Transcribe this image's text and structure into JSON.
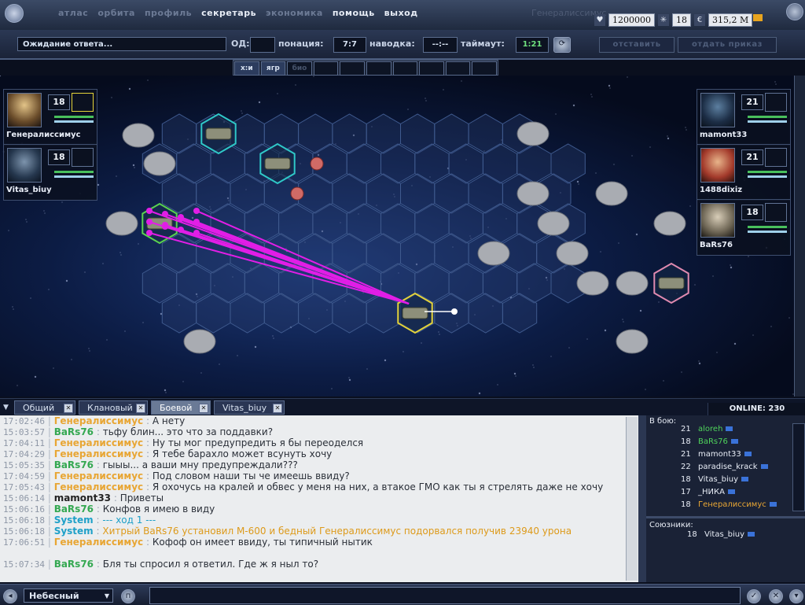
{
  "menu": {
    "items": [
      {
        "label": "атлас",
        "active": false
      },
      {
        "label": "орбита",
        "active": false
      },
      {
        "label": "профиль",
        "active": false
      },
      {
        "label": "секретарь",
        "active": true
      },
      {
        "label": "экономика",
        "active": false
      },
      {
        "label": "помощь",
        "active": true
      },
      {
        "label": "выход",
        "active": true
      }
    ],
    "player": "Генералиссимус"
  },
  "stats": {
    "money": "1200000",
    "level": "18",
    "mass": "315,2",
    "mass_unit": "М"
  },
  "status": {
    "message": "Ожидание ответа...",
    "og_label": "ОД:",
    "og_value": "",
    "ponaciya_label": "понация:",
    "ponaciya_value": "7:7",
    "navodka_label": "наводка:",
    "navodka_value": "--:--",
    "timeout_label": "таймаут:",
    "timeout_value": "1:21",
    "btn_leave": "отставить",
    "btn_order": "отдать приказ"
  },
  "mode_tabs": [
    "х:и",
    "ягр",
    "био",
    "",
    "",
    "",
    "",
    "",
    "",
    ""
  ],
  "left_players": [
    {
      "name": "Генералиссимус",
      "level": "18"
    },
    {
      "name": "Vitas_biuy",
      "level": "18"
    }
  ],
  "right_players": [
    {
      "name": "mamont33",
      "level": "21"
    },
    {
      "name": "1488dixiz",
      "level": "21"
    },
    {
      "name": "BaRs76",
      "level": "18"
    }
  ],
  "chat_tabs": [
    {
      "label": "Общий",
      "active": false
    },
    {
      "label": "Клановый",
      "active": false
    },
    {
      "label": "Боевой",
      "active": true
    },
    {
      "label": "Vitas_biuy",
      "active": false
    }
  ],
  "online": "ONLINE: 230",
  "messages": [
    {
      "time": "17:02:46",
      "name": "Генералиссимус",
      "color": "y",
      "text": "А нету"
    },
    {
      "time": "15:03:57",
      "name": "BaRs76",
      "color": "g",
      "text": "тьфу блин... это что за поддавки?"
    },
    {
      "time": "17:04:11",
      "name": "Генералиссимус",
      "color": "y",
      "text": "Ну ты мог предупредить я бы переоделся"
    },
    {
      "time": "17:04:29",
      "name": "Генералиссимус",
      "color": "y",
      "text": "Я тебе барахло может всунуть хочу"
    },
    {
      "time": "15:05:35",
      "name": "BaRs76",
      "color": "g",
      "text": "гыыы... а ваши мну предупреждали???"
    },
    {
      "time": "17:04:59",
      "name": "Генералиссимус",
      "color": "y",
      "text": "Под словом наши ты че имеешь ввиду?"
    },
    {
      "time": "17:05:43",
      "name": "Генералиссимус",
      "color": "y",
      "text": "Я охочусь на кралей и обвес у меня на них, а втакое ГМО как ты я стрелять даже не хочу"
    },
    {
      "time": "15:06:14",
      "name": "mamont33",
      "color": "d",
      "text": "Приветы"
    },
    {
      "time": "15:06:16",
      "name": "BaRs76",
      "color": "g",
      "text": "Конфов я имею в виду"
    },
    {
      "time": "15:06:18",
      "name": "System",
      "color": "c",
      "text": "--- ход 1 ---",
      "tcolor": "c"
    },
    {
      "time": "15:06:18",
      "name": "System",
      "color": "c",
      "text": "Хитрый BaRs76 установил М-600 и бедный Генералиссимус подорвался получив 23940 урона",
      "tcolor": "o"
    },
    {
      "time": "17:06:51",
      "name": "Генералиссимус",
      "color": "y",
      "text": "Кофоф он имеет ввиду, ты типичный нытик"
    },
    {
      "time": "15:07:34",
      "name": "BaRs76",
      "color": "g",
      "text": "Бля ты спросил я ответил. Где ж я ныл то?"
    }
  ],
  "side": {
    "in_battle_label": "В бою:",
    "in_battle": [
      {
        "level": "21",
        "name": "aloreh",
        "color": "#4fd35b"
      },
      {
        "level": "18",
        "name": "BaRs76",
        "color": "#4fd35b"
      },
      {
        "level": "21",
        "name": "mamont33",
        "color": "#e8edf6"
      },
      {
        "level": "22",
        "name": "paradise_krack",
        "color": "#e8edf6"
      },
      {
        "level": "18",
        "name": "Vitas_biuy",
        "color": "#e8edf6"
      },
      {
        "level": "17",
        "name": "_НИКА",
        "color": "#e8edf6"
      },
      {
        "level": "18",
        "name": "Генералиссимус",
        "color": "#e8a634"
      }
    ],
    "allies_label": "Союзники:",
    "allies": [
      {
        "level": "18",
        "name": "Vitas_biuy"
      }
    ]
  },
  "channel": "Небесный"
}
